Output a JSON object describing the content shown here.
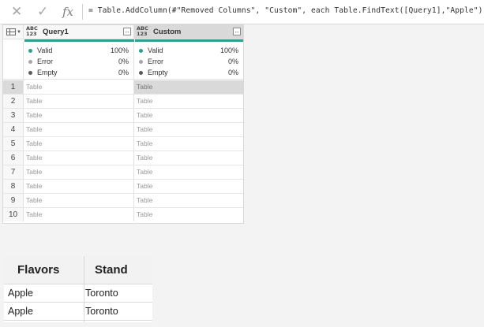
{
  "formula_bar": {
    "cancel_icon": "close-icon",
    "commit_icon": "check-icon",
    "fx_label": "fx",
    "formula": "= Table.AddColumn(#\"Removed Columns\", \"Custom\", each Table.FindText([Query1],\"Apple\"))"
  },
  "grid": {
    "columns": [
      {
        "type_top": "ABC",
        "type_bottom": "123",
        "title": "Query1",
        "expand": "↔",
        "stats": {
          "valid_label": "Valid",
          "valid": "100%",
          "error_label": "Error",
          "error": "0%",
          "empty_label": "Empty",
          "empty": "0%"
        }
      },
      {
        "type_top": "ABC",
        "type_bottom": "123",
        "title": "Custom",
        "expand": "↔",
        "stats": {
          "valid_label": "Valid",
          "valid": "100%",
          "error_label": "Error",
          "error": "0%",
          "empty_label": "Empty",
          "empty": "0%"
        }
      }
    ],
    "rows": [
      {
        "n": "1",
        "c1": "Table",
        "c2": "Table"
      },
      {
        "n": "2",
        "c1": "Table",
        "c2": "Table"
      },
      {
        "n": "3",
        "c1": "Table",
        "c2": "Table"
      },
      {
        "n": "4",
        "c1": "Table",
        "c2": "Table"
      },
      {
        "n": "5",
        "c1": "Table",
        "c2": "Table"
      },
      {
        "n": "6",
        "c1": "Table",
        "c2": "Table"
      },
      {
        "n": "7",
        "c1": "Table",
        "c2": "Table"
      },
      {
        "n": "8",
        "c1": "Table",
        "c2": "Table"
      },
      {
        "n": "9",
        "c1": "Table",
        "c2": "Table"
      },
      {
        "n": "10",
        "c1": "Table",
        "c2": "Table"
      }
    ],
    "colors": {
      "valid": "#2aa08e",
      "error": "#a6a6a6",
      "empty": "#595959",
      "quality_bar": "#2aa08e"
    }
  },
  "flavors_table": {
    "headers": [
      "Flavors",
      "Stand"
    ],
    "rows": [
      [
        "Apple",
        "Toronto"
      ],
      [
        "Apple",
        "Toronto"
      ]
    ]
  }
}
